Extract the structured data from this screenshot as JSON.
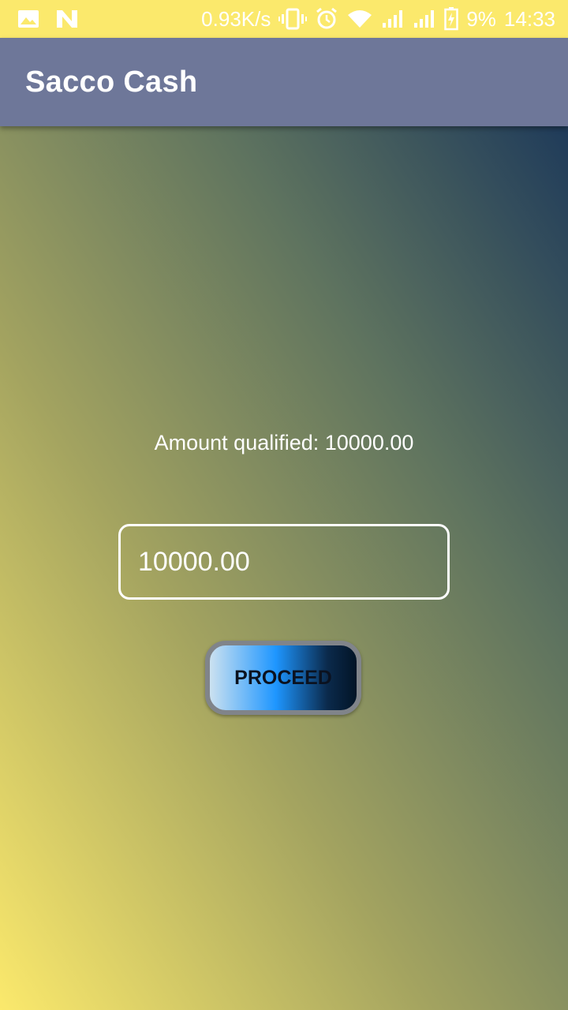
{
  "status_bar": {
    "network_speed": "0.93K/s",
    "battery_percent": "9%",
    "time": "14:33",
    "icons": [
      "image-icon",
      "n-app-icon",
      "vibrate-icon",
      "alarm-icon",
      "wifi-icon",
      "signal-icon",
      "signal-icon",
      "battery-icon"
    ]
  },
  "app_bar": {
    "title": "Sacco Cash",
    "color": "#6e7799"
  },
  "main": {
    "qualified_label": "Amount qualified: 10000.00",
    "amount_value": "10000.00",
    "proceed_label": "PROCEED"
  },
  "colors": {
    "status_bar": "#fbe96c",
    "gradient_bottom_left": "#fbe96c",
    "gradient_top_right": "#1f3b5a"
  }
}
